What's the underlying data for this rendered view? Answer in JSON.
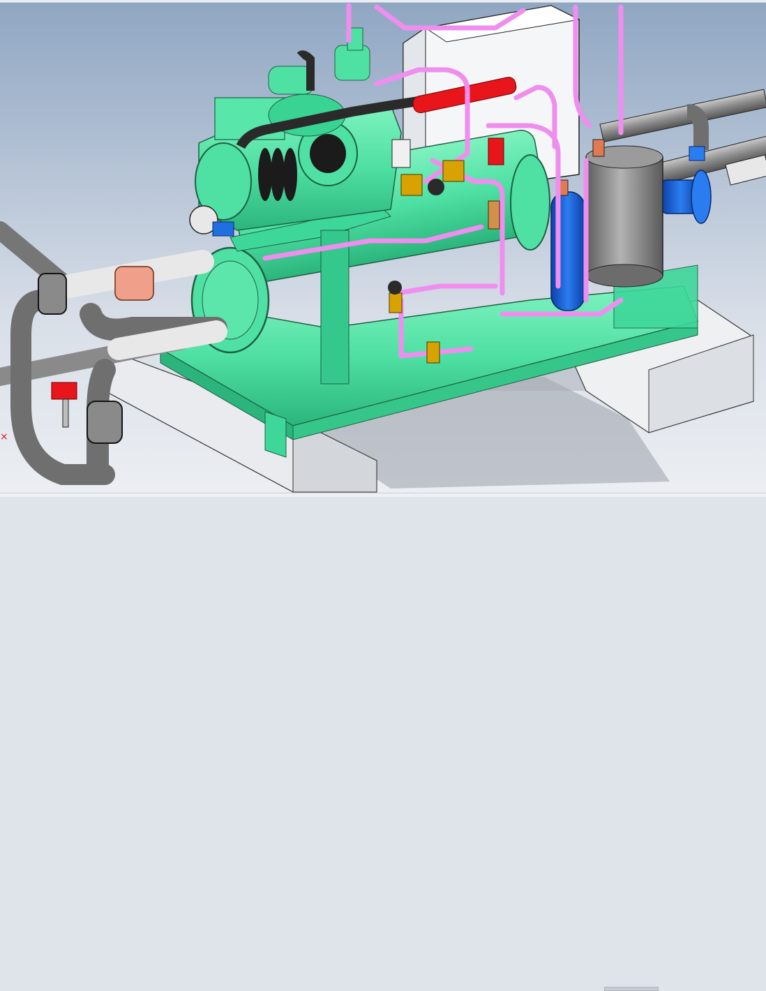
{
  "viewport": {
    "model": "refrigeration-condensing-unit",
    "background_top": "#8fa6c2",
    "background_bottom": "#eceff3"
  },
  "colors": {
    "frame_green": "#4fe0a3",
    "pipe_pink": "#f08ef0",
    "pipe_gray": "#8a8a8a",
    "valve_red": "#e8161a",
    "receiver_blue": "#1f6fe0",
    "accumulator_gray": "#8e8e8e",
    "concrete": "#f2f3f5",
    "shadow": "#9aa1aa"
  },
  "axis_marker": {
    "glyph": "×",
    "icon": "axis-triad-icon"
  },
  "status": {
    "item": ""
  }
}
